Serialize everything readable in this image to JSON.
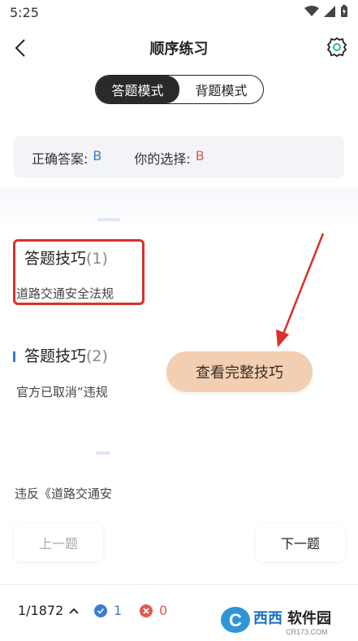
{
  "status_bar": {
    "time": "5:25"
  },
  "header": {
    "title": "顺序练习"
  },
  "mode_toggle": {
    "active": "答题模式",
    "inactive": "背题模式"
  },
  "answer_panel": {
    "correct_label": "正确答案:",
    "correct_value": "B",
    "choice_label": "你的选择:",
    "choice_value": "B"
  },
  "tips": [
    {
      "title": "答题技巧",
      "num": "(1)",
      "text": "道路交通安全法规"
    },
    {
      "title": "答题技巧",
      "num": "(2)",
      "text": "官方已取消“违规"
    },
    {
      "title": "",
      "num": "",
      "text": "违反《道路交通安"
    }
  ],
  "view_full_button": "查看完整技巧",
  "nav": {
    "prev": "上一题",
    "next": "下一题"
  },
  "bottom_bar": {
    "progress": "1/1872",
    "correct_count": "1",
    "wrong_count": "0"
  },
  "watermark": {
    "text": "西西软件园",
    "sub": "CR173.COM"
  },
  "colors": {
    "accent_blue": "#3a7bd5",
    "error_red": "#e05a4f",
    "button_peach": "#f2cfb2",
    "highlight_red": "#d9302c"
  }
}
